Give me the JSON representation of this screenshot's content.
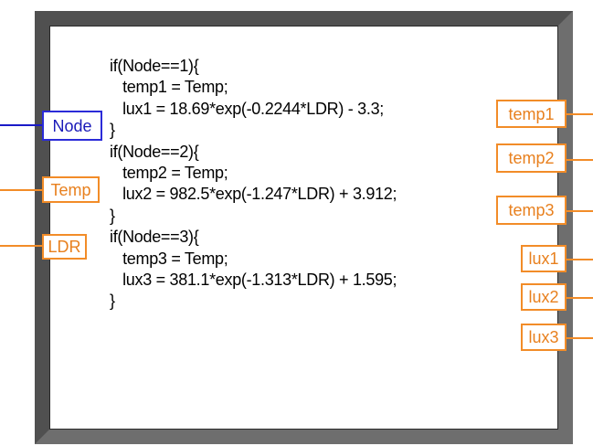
{
  "code_lines": [
    "if(Node==1){",
    "   temp1 = Temp;",
    "   lux1 = 18.69*exp(-0.2244*LDR) - 3.3;",
    "}",
    "if(Node==2){",
    "   temp2 = Temp;",
    "   lux2 = 982.5*exp(-1.247*LDR) + 3.912;",
    "}",
    "if(Node==3){",
    "   temp3 = Temp;",
    "   lux3 = 381.1*exp(-1.313*LDR) + 1.595;",
    "}"
  ],
  "inputs": {
    "node": "Node",
    "temp": "Temp",
    "ldr": "LDR"
  },
  "outputs": {
    "temp1": "temp1",
    "temp2": "temp2",
    "temp3": "temp3",
    "lux1": "lux1",
    "lux2": "lux2",
    "lux3": "lux3"
  },
  "colors": {
    "input_blue": "#2b2bd8",
    "terminal_orange": "#f28c28",
    "frame": "#505050"
  }
}
